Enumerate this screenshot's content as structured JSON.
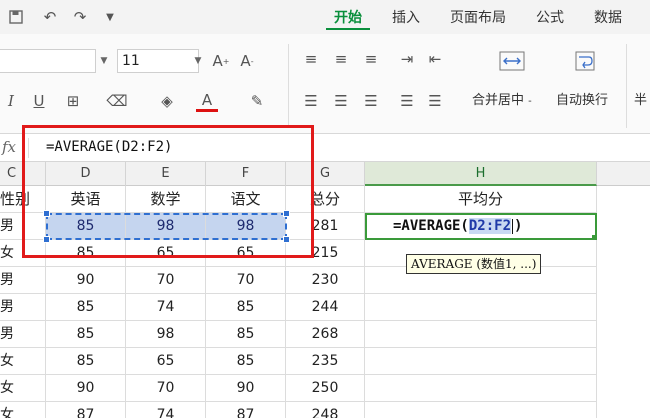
{
  "tabs": [
    {
      "label": "开始",
      "active": true
    },
    {
      "label": "插入",
      "active": false
    },
    {
      "label": "页面布局",
      "active": false
    },
    {
      "label": "公式",
      "active": false
    },
    {
      "label": "数据",
      "active": false
    }
  ],
  "quick_access": {
    "icons": [
      "save-icon",
      "undo-icon",
      "redo-icon",
      "customize-icon"
    ]
  },
  "ribbon": {
    "font_name": "",
    "font_size": "11",
    "merge_label": "合并居中",
    "merge_caret": "-",
    "wrap_label": "自动换行",
    "partial_label": "半"
  },
  "formula_bar": {
    "fx": "fx",
    "text": "=AVERAGE(D2:F2)"
  },
  "columns": [
    "C",
    "D",
    "E",
    "F",
    "G",
    "H"
  ],
  "header_row": [
    "性别",
    "英语",
    "数学",
    "语文",
    "总分",
    "平均分"
  ],
  "rows": [
    [
      "男",
      "85",
      "98",
      "98",
      "281"
    ],
    [
      "女",
      "85",
      "65",
      "65",
      "215"
    ],
    [
      "男",
      "90",
      "70",
      "70",
      "230"
    ],
    [
      "男",
      "85",
      "74",
      "85",
      "244"
    ],
    [
      "男",
      "85",
      "98",
      "85",
      "268"
    ],
    [
      "女",
      "85",
      "65",
      "85",
      "235"
    ],
    [
      "女",
      "90",
      "70",
      "90",
      "250"
    ],
    [
      "女",
      "87",
      "74",
      "87",
      "248"
    ]
  ],
  "active_cell": {
    "prefix": "=AVERAGE(",
    "ref": "D2:F2",
    "suffix": ")"
  },
  "tooltip": "AVERAGE (数值1, ...)",
  "colors": {
    "accent_green": "#0a8f3c",
    "annotation_red": "#e11a1a",
    "selection_blue": "#2f6fd1",
    "selection_fill": "#c5d5ef"
  }
}
